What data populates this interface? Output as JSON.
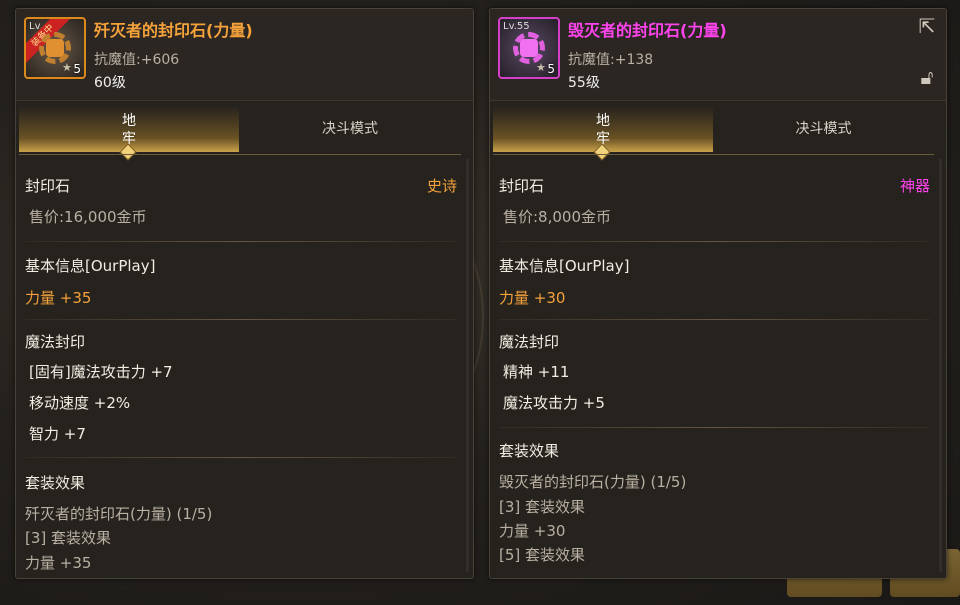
{
  "left": {
    "icon": {
      "lv_label": "Lv.",
      "badge": "装备中",
      "count": "5",
      "name": "fist-gear-icon"
    },
    "name": "歼灭者的封印石(力量)",
    "name_color": "#f5a23a",
    "resist": "抗魔值:+606",
    "level": "60级",
    "tabs": {
      "active": "地\n牢",
      "inactive": "决斗模式"
    },
    "category": "封印石",
    "rarity": "史诗",
    "rarity_color": "#f5a23a",
    "price": "售价:16,000金币",
    "basic_title": "基本信息[OurPlay]",
    "basic_stat": "力量 +35",
    "magic_title": "魔法封印",
    "magic_stats": [
      "[固有]魔法攻击力 +7",
      "移动速度 +2%",
      "智力 +7"
    ],
    "set_title": "套装效果",
    "set_lines": [
      "歼灭者的封印石(力量) (1/5)",
      "[3] 套装效果",
      "力量 +35"
    ]
  },
  "right": {
    "icon": {
      "lv_label": "Lv.55",
      "count": "5",
      "name": "fist-gear-icon"
    },
    "name": "毁灭者的封印石(力量)",
    "name_color": "#ff44ee",
    "resist": "抗魔值:+138",
    "level": "55级",
    "tabs": {
      "active": "地\n牢",
      "inactive": "决斗模式"
    },
    "category": "封印石",
    "rarity": "神器",
    "rarity_color": "#ff44ee",
    "price": "售价:8,000金币",
    "basic_title": "基本信息[OurPlay]",
    "basic_stat": "力量 +30",
    "magic_title": "魔法封印",
    "magic_stats": [
      "精神 +11",
      "魔法攻击力 +5"
    ],
    "set_title": "套装效果",
    "set_lines": [
      "毁灭者的封印石(力量) (1/5)",
      "[3] 套装效果",
      "力量 +30",
      "[5] 套装效果"
    ]
  }
}
